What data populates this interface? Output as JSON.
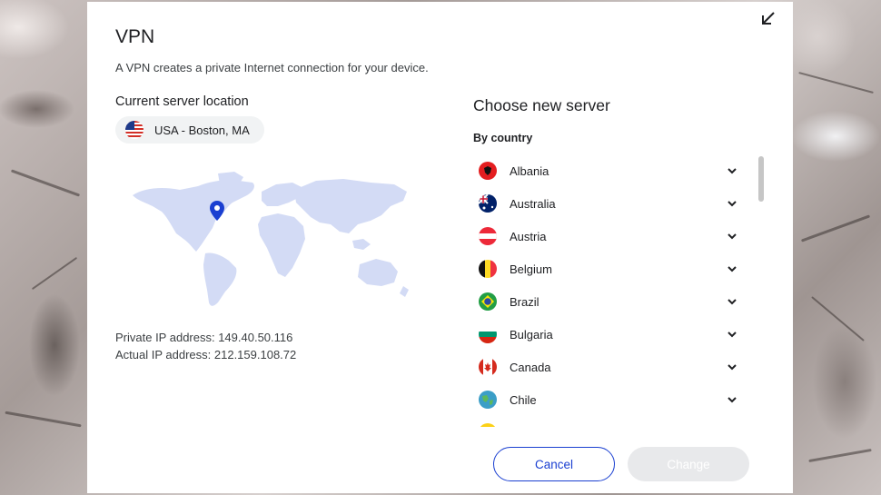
{
  "dialog": {
    "title": "VPN",
    "subtitle": "A VPN creates a private Internet connection for your device.",
    "collapse_icon": "arrow-down-left-icon"
  },
  "current": {
    "label": "Current server location",
    "location": "USA - Boston, MA",
    "flag_icon": "usa-flag-icon",
    "private_ip": "Private IP address: 149.40.50.116",
    "actual_ip": "Actual IP address: 212.159.108.72"
  },
  "servers": {
    "title": "Choose new server",
    "group_label": "By country",
    "countries": [
      {
        "name": "Albania"
      },
      {
        "name": "Australia"
      },
      {
        "name": "Austria"
      },
      {
        "name": "Belgium"
      },
      {
        "name": "Brazil"
      },
      {
        "name": "Bulgaria"
      },
      {
        "name": "Canada"
      },
      {
        "name": "Chile"
      },
      {
        "name": ""
      }
    ]
  },
  "buttons": {
    "cancel": "Cancel",
    "change": "Change"
  },
  "colors": {
    "accent": "#1a3fd1",
    "map": "#d3dbf5",
    "pin": "#1a3fd1",
    "disabled_button": "#e8e9eb"
  }
}
